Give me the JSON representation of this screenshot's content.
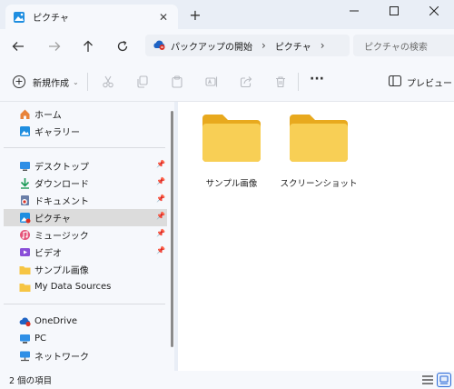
{
  "tab": {
    "title": "ピクチャ"
  },
  "window": {
    "new_tab": "+"
  },
  "address": {
    "crumbs": [
      "パックアップの開始",
      "ピクチャ"
    ]
  },
  "search": {
    "placeholder": "ピクチャの検索"
  },
  "toolbar": {
    "new_label": "新規作成",
    "preview_label": "プレビュー"
  },
  "sidebar": {
    "items": [
      {
        "label": "ホーム",
        "icon": "home-icon",
        "pinned": false
      },
      {
        "label": "ギャラリー",
        "icon": "gallery-icon",
        "pinned": false
      },
      {
        "label": "デスクトップ",
        "icon": "desktop-icon",
        "pinned": true
      },
      {
        "label": "ダウンロード",
        "icon": "download-icon",
        "pinned": true
      },
      {
        "label": "ドキュメント",
        "icon": "documents-icon",
        "pinned": true
      },
      {
        "label": "ピクチャ",
        "icon": "pictures-icon",
        "pinned": true,
        "selected": true
      },
      {
        "label": "ミュージック",
        "icon": "music-icon",
        "pinned": true
      },
      {
        "label": "ビデオ",
        "icon": "video-icon",
        "pinned": true
      },
      {
        "label": "サンプル画像",
        "icon": "folder-icon",
        "pinned": false
      },
      {
        "label": "My Data Sources",
        "icon": "folder-icon",
        "pinned": false
      },
      {
        "label": "OneDrive",
        "icon": "onedrive-icon",
        "pinned": false
      },
      {
        "label": "PC",
        "icon": "pc-icon",
        "pinned": false
      },
      {
        "label": "ネットワーク",
        "icon": "network-icon",
        "pinned": false
      }
    ]
  },
  "content": {
    "folders": [
      {
        "label": "サンプル画像"
      },
      {
        "label": "スクリーンショット"
      }
    ]
  },
  "status": {
    "item_count": "2 個の項目"
  },
  "colors": {
    "accent": "#2c6bd8",
    "folder": "#f6c544",
    "selected_bg": "#dcdcdc"
  }
}
